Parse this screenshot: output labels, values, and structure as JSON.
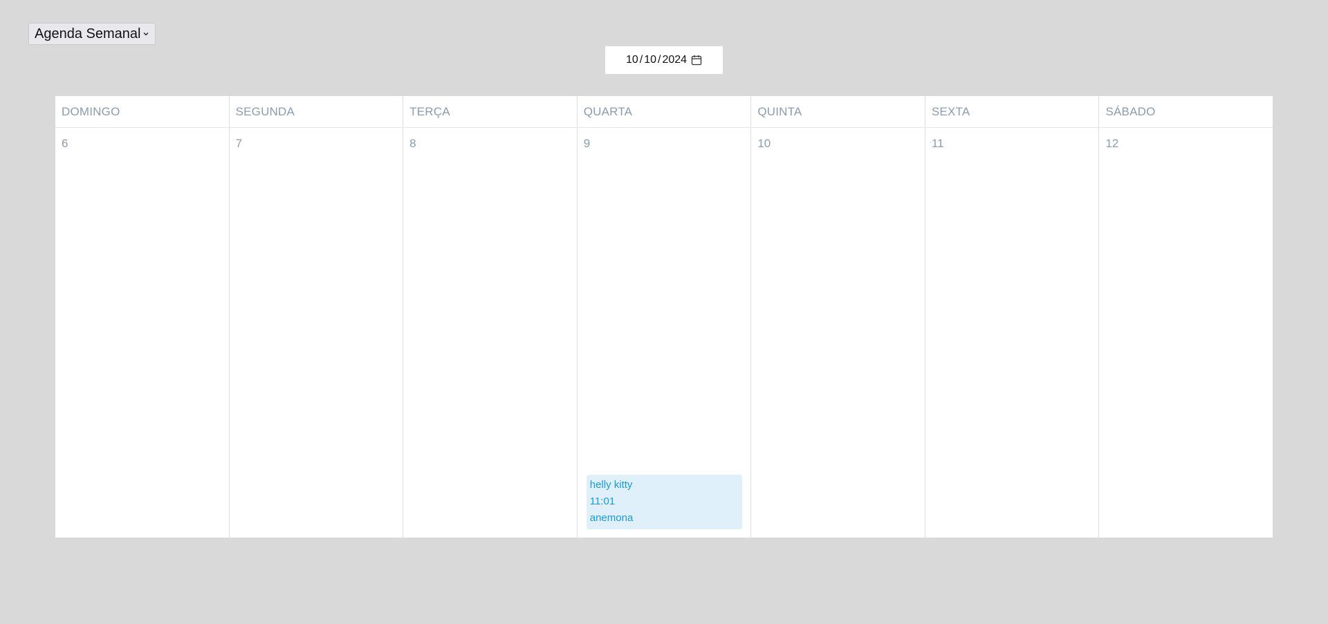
{
  "view_select": {
    "label": "Agenda Semanal"
  },
  "date_picker": {
    "day": "10",
    "month": "10",
    "year": "2024"
  },
  "calendar": {
    "days": [
      {
        "name": "DOMINGO",
        "number": "6"
      },
      {
        "name": "SEGUNDA",
        "number": "7"
      },
      {
        "name": "TERÇA",
        "number": "8"
      },
      {
        "name": "QUARTA",
        "number": "9"
      },
      {
        "name": "QUINTA",
        "number": "10"
      },
      {
        "name": "SEXTA",
        "number": "11"
      },
      {
        "name": "SÁBADO",
        "number": "12"
      }
    ],
    "event": {
      "title": "helly kitty",
      "time": "11:01",
      "location": "anemona"
    }
  },
  "colors": {
    "background": "#d9d9d9",
    "day_text": "#8b9bb0",
    "event_bg": "#dff0fb",
    "event_text": "#1b9ad6"
  },
  "icons": {
    "view_chevron": "chevron-down-icon",
    "date_calendar": "calendar-icon"
  }
}
